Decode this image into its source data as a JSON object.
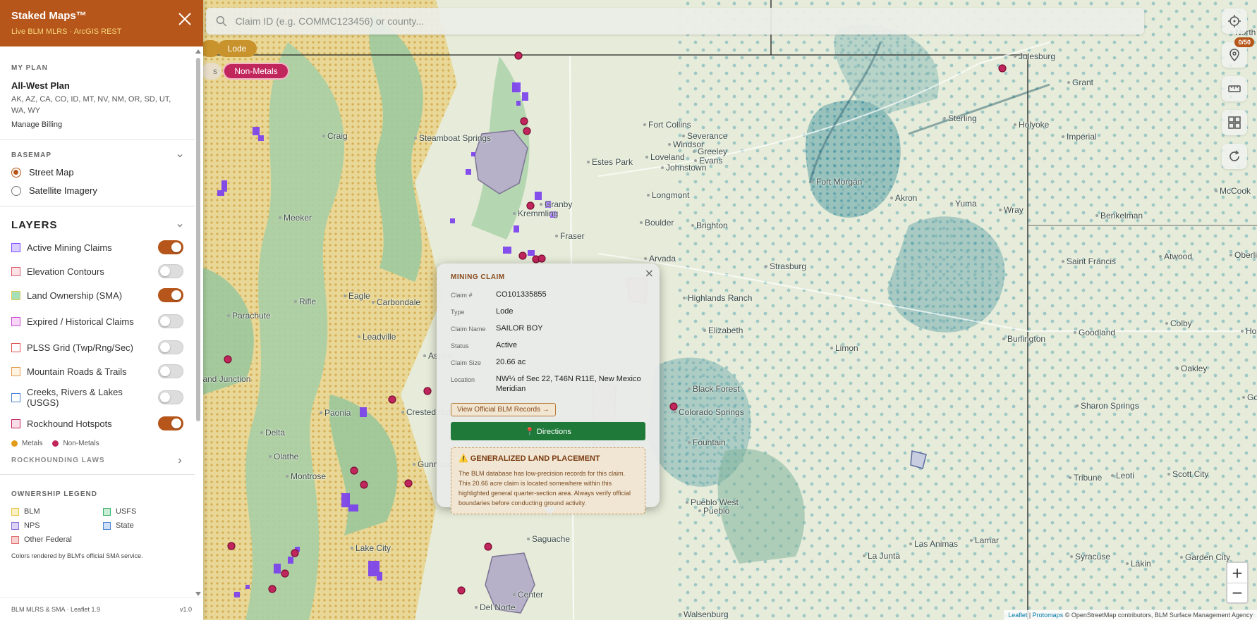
{
  "app": {
    "title": "Staked Maps™",
    "subtitle": "Live BLM MLRS · ArcGIS REST"
  },
  "plan": {
    "section_label": "MY PLAN",
    "name": "All-West Plan",
    "states": "AK, AZ, CA, CO, ID, MT, NV, NM, OR, SD, UT, WA, WY",
    "manage_label": "Manage Billing"
  },
  "basemap": {
    "section_label": "BASEMAP",
    "options": [
      {
        "label": "Street Map",
        "selected": true
      },
      {
        "label": "Satellite Imagery",
        "selected": false
      }
    ]
  },
  "layers": {
    "heading": "LAYERS",
    "items": [
      {
        "label": "Active Mining Claims",
        "on": true,
        "color": "#7c4dff",
        "fill": "#d9ccff"
      },
      {
        "label": "Elevation Contours",
        "on": false,
        "color": "#d65c6e",
        "fill": "#fde3e6"
      },
      {
        "label": "Land Ownership (SMA)",
        "on": true,
        "color": "#e0c85a",
        "fill": "#a6e0b8"
      },
      {
        "label": "Expired / Historical Claims",
        "on": false,
        "color": "#c74fcf",
        "fill": "#f7d6f8"
      },
      {
        "label": "PLSS Grid (Twp/Rng/Sec)",
        "on": false,
        "color": "#d9534f",
        "fill": "#ffffff"
      },
      {
        "label": "Mountain Roads & Trails",
        "on": false,
        "color": "#e39b4c",
        "fill": "#fff3e3"
      },
      {
        "label": "Creeks, Rivers & Lakes (USGS)",
        "on": false,
        "color": "#4a7fd6",
        "fill": "#ffffff"
      },
      {
        "label": "Rockhound Hotspots",
        "on": true,
        "color": "#c0265c",
        "fill": "#f9dde8"
      }
    ],
    "legend": {
      "metals": "Metals",
      "nonmetals": "Non-Metals",
      "metals_color": "#e39b1c",
      "nonmetals_color": "#c0265c"
    },
    "rockhounding_label": "ROCKHOUNDING LAWS"
  },
  "ownership": {
    "section_label": "OWNERSHIP LEGEND",
    "items": [
      {
        "label": "BLM",
        "color": "#e8c547",
        "fill": "#fbf1c4"
      },
      {
        "label": "USFS",
        "color": "#3cb371",
        "fill": "#c9ecd4"
      },
      {
        "label": "NPS",
        "color": "#8a6fd6",
        "fill": "#ddd3f6"
      },
      {
        "label": "State",
        "color": "#4a86d6",
        "fill": "#cfe0f6"
      },
      {
        "label": "Other Federal",
        "color": "#e07070",
        "fill": "#f8d2d2"
      }
    ],
    "note": "Colors rendered by BLM's official SMA service."
  },
  "footer": {
    "left": "BLM MLRS & SMA · Leaflet 1.9",
    "right": "v1.0"
  },
  "search": {
    "placeholder": "Claim ID (e.g. COMMC123456) or county..."
  },
  "chips": {
    "lode": "Lode",
    "nonmetals": "Non-Metals",
    "frag": "s"
  },
  "claims_counter": "0/50",
  "popup": {
    "title": "MINING CLAIM",
    "fields": [
      {
        "k": "Claim #",
        "v": "CO101335855"
      },
      {
        "k": "Type",
        "v": "Lode"
      },
      {
        "k": "Claim Name",
        "v": "SAILOR BOY"
      },
      {
        "k": "Status",
        "v": "Active"
      },
      {
        "k": "Claim Size",
        "v": "20.66 ac"
      },
      {
        "k": "Location",
        "v": "NW¼ of Sec 22, T46N R11E, New Mexico Meridian"
      }
    ],
    "blm_link": "View Official BLM Records →",
    "directions": "📍 Directions",
    "warn_title": "⚠️ GENERALIZED LAND PLACEMENT",
    "warn_body": "The BLM database has low-precision records for this claim. This 20.66 acre claim is located somewhere within this highlighted general quarter-section area. Always verify official boundaries before conducting ground activity."
  },
  "zoom": {
    "in": "+",
    "out": "−"
  },
  "attribution": {
    "leaflet": "Leaflet",
    "protomaps": "Protomaps",
    "rest": "© OpenStreetMap contributors, BLM Surface Management Agency"
  },
  "places": [
    "Fort Collins",
    "Severance",
    "Windsor",
    "Loveland",
    "Greeley",
    "Evans",
    "Johnstown",
    "Estes Park",
    "Longmont",
    "Boulder",
    "Brighton",
    "Arvada",
    "Strasburg",
    "Highlands Ranch",
    "Elizabeth",
    "Limon",
    "Burlington",
    "Fort Morgan",
    "Akron",
    "Yuma",
    "Wray",
    "Sterling",
    "Holyoke",
    "Imperial",
    "Grant",
    "Julesburg",
    "North",
    "Benkelman",
    "McCook",
    "Saint Francis",
    "Atwood",
    "Oberlin",
    "Goodland",
    "Colby",
    "Hoxie",
    "Oakley",
    "Gove",
    "Sharon Springs",
    "Tribune",
    "Leoti",
    "Scott City",
    "Syracuse",
    "Lakin",
    "Garden City",
    "Lamar",
    "La Junta",
    "Las Animas",
    "Pueblo West",
    "Pueblo",
    "Fountain",
    "Black Forest",
    "Colorado Springs",
    "Craig",
    "Steamboat Springs",
    "Meeker",
    "Rifle",
    "Carbondale",
    "Aspen",
    "Leadville",
    "Crested Butte",
    "Gunnison",
    "Delta",
    "Olathe",
    "Montrose",
    "Paonia",
    "Grand Junction",
    "Lake City",
    "Saguache",
    "Center",
    "Del Norte",
    "Walsenburg",
    "Granby",
    "Fraser",
    "Kremmling",
    "Eagle",
    "Parachute"
  ]
}
